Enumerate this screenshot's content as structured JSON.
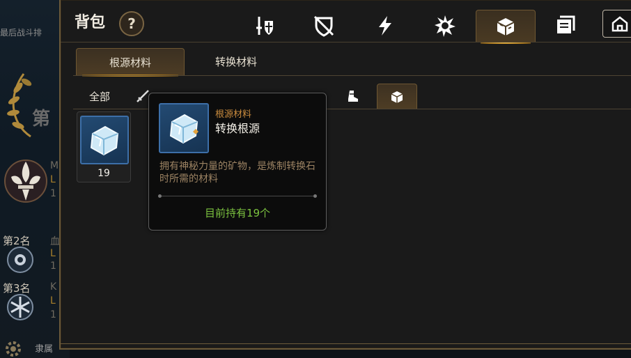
{
  "background": {
    "last_battle_label": "最后战斗排",
    "rank_first_char": "第",
    "rank2_label": "第2名",
    "rank3_label": "第3名",
    "side_letters": [
      "M",
      "L",
      "1",
      "血",
      "L",
      "1",
      "K",
      "L",
      "1"
    ],
    "guild_text": "隶属"
  },
  "panel": {
    "title": "背包",
    "help_label": "?",
    "top_tabs": [
      {
        "icon": "sword-shield-icon",
        "active": false
      },
      {
        "icon": "broken-shield-icon",
        "active": false
      },
      {
        "icon": "lightning-icon",
        "active": false
      },
      {
        "icon": "spiky-gem-icon",
        "active": false
      },
      {
        "icon": "ore-cube-icon",
        "active": true
      },
      {
        "icon": "scroll-box-icon",
        "active": false
      },
      {
        "icon": "house-icon",
        "active": false
      }
    ],
    "sub_tabs": [
      "根源材料",
      "转换材料"
    ],
    "filters": {
      "all_label": "全部",
      "icons": [
        "sword-icon",
        "helmet-icon",
        "armor-icon",
        "crossed-weapons-icon",
        "glove-icon",
        "boot-icon",
        "ore-cube-icon"
      ]
    }
  },
  "inventory": [
    {
      "name": "转换根源",
      "count": "19",
      "icon": "crystal-cube-icon"
    }
  ],
  "tooltip": {
    "category": "根源材料",
    "name": "转换根源",
    "description": "拥有神秘力量的矿物，是炼制转换石时所需的材料",
    "owned": "目前持有19个"
  },
  "colors": {
    "gold_border": "#6b5a3a",
    "active_tab_glow": "#ffcf5a",
    "category_text": "#c98b3e",
    "owned_text": "#7bc23f",
    "desc_text": "#9b8262"
  }
}
